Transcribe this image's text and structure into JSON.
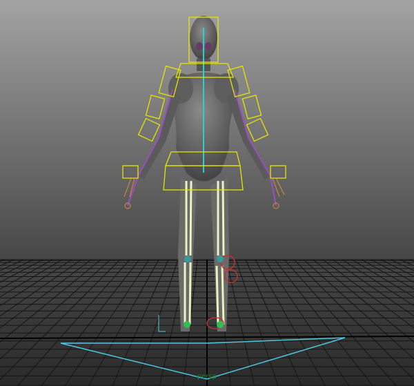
{
  "viewport": {
    "camera_label": "persp",
    "colors": {
      "bg_top": "#9a9a9a",
      "bg_bottom": "#3a3a3a",
      "grid": "#111111",
      "controls": "#e6e600",
      "skeleton": "#e8f0c8",
      "curve": "#4cc8e0"
    }
  }
}
